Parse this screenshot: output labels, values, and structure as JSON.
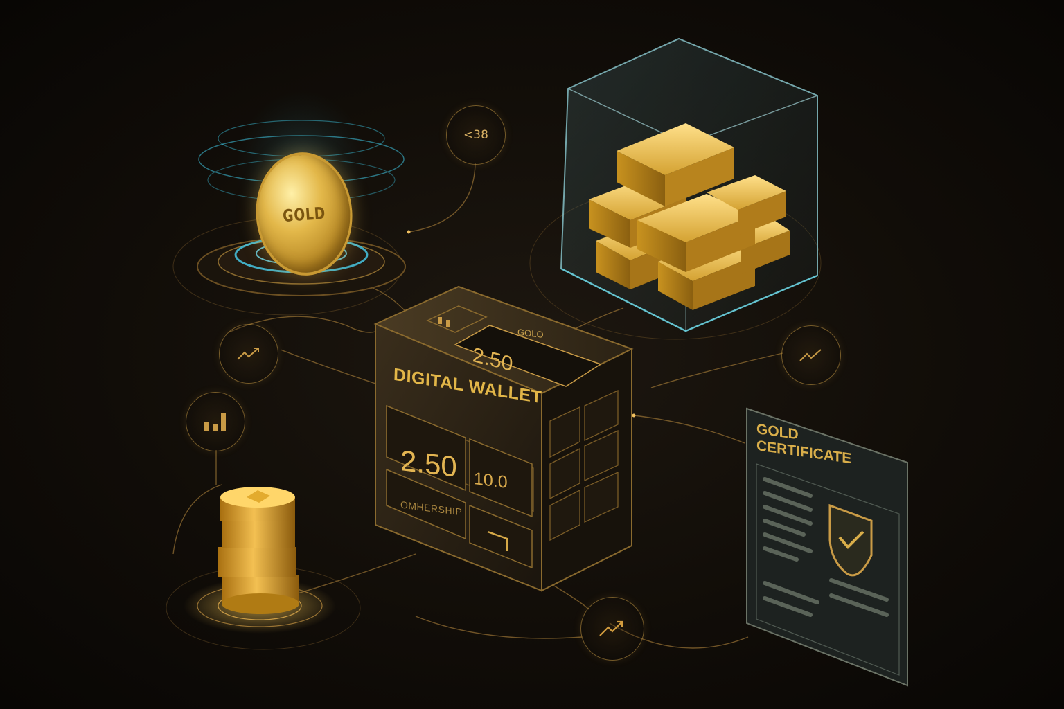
{
  "coin": {
    "label": "GOLD"
  },
  "badges": {
    "top_counter": "<38",
    "left_trend_icon": "trend-icon",
    "left_bars_icon": "bar-chart-icon",
    "right_trend_icon": "trend-icon",
    "bottom_trend_icon": "trend-up-icon"
  },
  "wallet": {
    "title": "DIGITAL WALLET",
    "amount": "2.50",
    "secondary_value": "10.0",
    "ownership_label": "OMHERSHIP",
    "top_label": "GOLO",
    "top_amount": "2.50"
  },
  "certificate": {
    "title": "GOLD CERTIFICATE",
    "shield_icon": "shield-check-icon"
  },
  "colors": {
    "background": "#110d08",
    "gold": "#e2b453",
    "gold_line": "#c99b46",
    "hologram_cyan": "#3fc9e6"
  }
}
